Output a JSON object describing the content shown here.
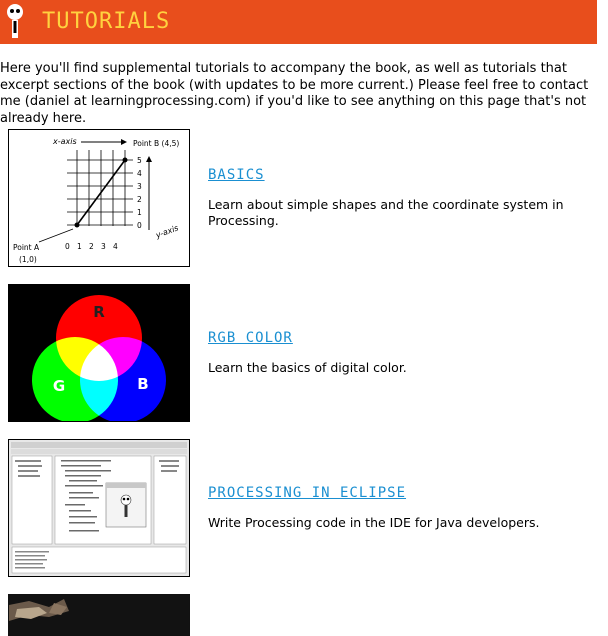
{
  "header": {
    "title": "TUTORIALS",
    "accent_color": "#e84e1c",
    "title_color": "#ffd23f",
    "logo_icon": "robot-icon"
  },
  "intro": "Here you'll find supplemental tutorials to accompany the book, as well as tutorials that excerpt sections of the book (with updates to be more current.) Please feel free to contact me (daniel at learningprocessing.com) if you'd like to see anything on this page that's not already here.",
  "tutorials": [
    {
      "title": "BASICS",
      "description": "Learn about simple shapes and the coordinate system in Processing.",
      "diagram": {
        "xaxis_label": "x-axis",
        "yaxis_label": "y-axis",
        "point_a_label": "Point A",
        "point_a_coords": "(1,0)",
        "point_b_label": "Point B (4,5)",
        "x_ticks": [
          "0",
          "1",
          "2",
          "3",
          "4"
        ],
        "y_ticks": [
          "5",
          "4",
          "3",
          "2",
          "1",
          "0"
        ]
      }
    },
    {
      "title": "RGB COLOR",
      "description": "Learn the basics of digital color.",
      "diagram": {
        "r_label": "R",
        "g_label": "G",
        "b_label": "B"
      }
    },
    {
      "title": "PROCESSING IN ECLIPSE",
      "description": "Write Processing code in the IDE for Java developers."
    }
  ]
}
